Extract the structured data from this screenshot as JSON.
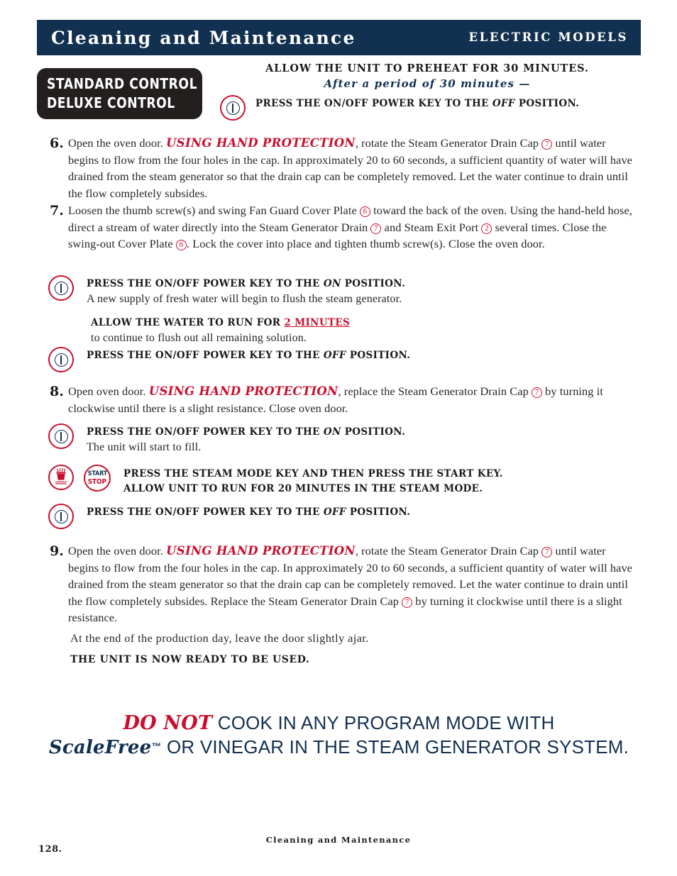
{
  "colors": {
    "navy": "#123050",
    "red": "#c8102e",
    "badge_black": "#231f1e",
    "body_text": "#262626"
  },
  "header": {
    "title": "Cleaning and Maintenance",
    "models": "ELECTRIC MODELS"
  },
  "control_badge": {
    "line1": "STANDARD CONTROL",
    "line2": "DELUXE CONTROL"
  },
  "preheat": {
    "line1": "ALLOW THE UNIT TO PREHEAT FOR 30 MINUTES.",
    "line2": "After a period of 30 minutes —"
  },
  "top_power_row": {
    "icon": "power-on-off-icon",
    "text_prefix": "PRESS THE ON/OFF POWER KEY TO THE ",
    "text_state": "OFF",
    "text_suffix": " POSITION."
  },
  "steps": [
    {
      "number": "6.",
      "seg1": "Open the oven door. ",
      "emphasis": "USING HAND PROTECTION",
      "seg2": ", rotate the Steam Generator Drain Cap ",
      "ref1": "7",
      "seg3": " until water begins to flow from the four holes in the cap. In approximately 20 to 60 seconds, a sufficient quantity of water will have drained from the steam generator so that the drain cap can be completely removed. Let the water continue to drain until the flow completely subsides."
    },
    {
      "number": "7.",
      "seg1": "Loosen the thumb screw(s) and swing Fan Guard Cover Plate ",
      "ref1": "6",
      "seg2": " toward the back of the oven. Using the hand-held hose, direct a stream of water directly into the Steam Generator Drain ",
      "ref2": "7",
      "seg3": " and Steam Exit Port ",
      "ref3": "2",
      "seg4": " several times. Close the swing-out Cover Plate ",
      "ref4": "6",
      "seg5": ". Lock the cover into place and tighten thumb screw(s). Close the oven door."
    },
    {
      "number": "8.",
      "seg1": "Open oven door. ",
      "emphasis": "USING HAND PROTECTION",
      "seg2": ", replace the Steam Generator Drain Cap ",
      "ref1": "7",
      "seg3": " by turning it clockwise until there is a slight resistance. Close oven door."
    },
    {
      "number": "9.",
      "seg1": "Open the oven door. ",
      "emphasis": "USING HAND PROTECTION",
      "seg2": ", rotate the Steam Generator Drain Cap ",
      "ref1": "7",
      "seg3": " until water begins to flow from the four holes in the cap. In approximately 20 to 60 seconds, a sufficient quantity of water will have drained from the steam generator so that the drain cap can be completely removed. Let the water continue to drain until the flow completely subsides. Replace the Steam Generator Drain Cap ",
      "ref2": "7",
      "seg4": " by turning it clockwise until there is a slight resistance."
    }
  ],
  "key_rows": {
    "row_on_flush": {
      "icon": "power-on-off-icon",
      "bold_prefix": "PRESS THE ON/OFF POWER KEY TO THE ",
      "bold_state": "ON",
      "bold_suffix": " POSITION.",
      "plain": "A new supply of fresh water will begin to flush the steam generator."
    },
    "row_two_minutes": {
      "bold_prefix": "ALLOW THE WATER TO RUN FOR ",
      "highlight": "2 MINUTES",
      "plain": "to continue to flush out all remaining solution."
    },
    "row_off_1": {
      "icon": "power-on-off-icon",
      "bold_prefix": "PRESS THE ON/OFF POWER KEY TO THE ",
      "bold_state": "OFF",
      "bold_suffix": " POSITION."
    },
    "row_on_fill": {
      "icon": "power-on-off-icon",
      "bold_prefix": "PRESS THE ON/OFF POWER KEY TO THE ",
      "bold_state": "ON",
      "bold_suffix": " POSITION.",
      "plain": "The unit will start to fill."
    },
    "row_steam_mode": {
      "icon_steam": "steam-mode-icon",
      "icon_startstop": "start-stop-icon",
      "startstop_top": "START",
      "startstop_bottom": "STOP",
      "line1": "PRESS THE STEAM MODE KEY AND THEN PRESS THE START KEY.",
      "line2": "ALLOW UNIT TO RUN FOR 20 MINUTES IN THE STEAM MODE."
    },
    "row_off_2": {
      "icon": "power-on-off-icon",
      "bold_prefix": "PRESS THE ON/OFF POWER KEY TO THE ",
      "bold_state": "OFF",
      "bold_suffix": " POSITION."
    }
  },
  "closing": {
    "plain": "At the end of the production day, leave the door slightly ajar.",
    "bold": "THE UNIT IS NOW READY TO BE USED."
  },
  "warning": {
    "donot": "DO NOT",
    "line1_rest": " COOK IN ANY PROGRAM MODE WITH",
    "brand": "ScaleFree",
    "tm": "™",
    "line2_rest": " OR VINEGAR IN THE STEAM GENERATOR SYSTEM."
  },
  "footer": {
    "page": "128.",
    "center": "Cleaning and Maintenance"
  }
}
